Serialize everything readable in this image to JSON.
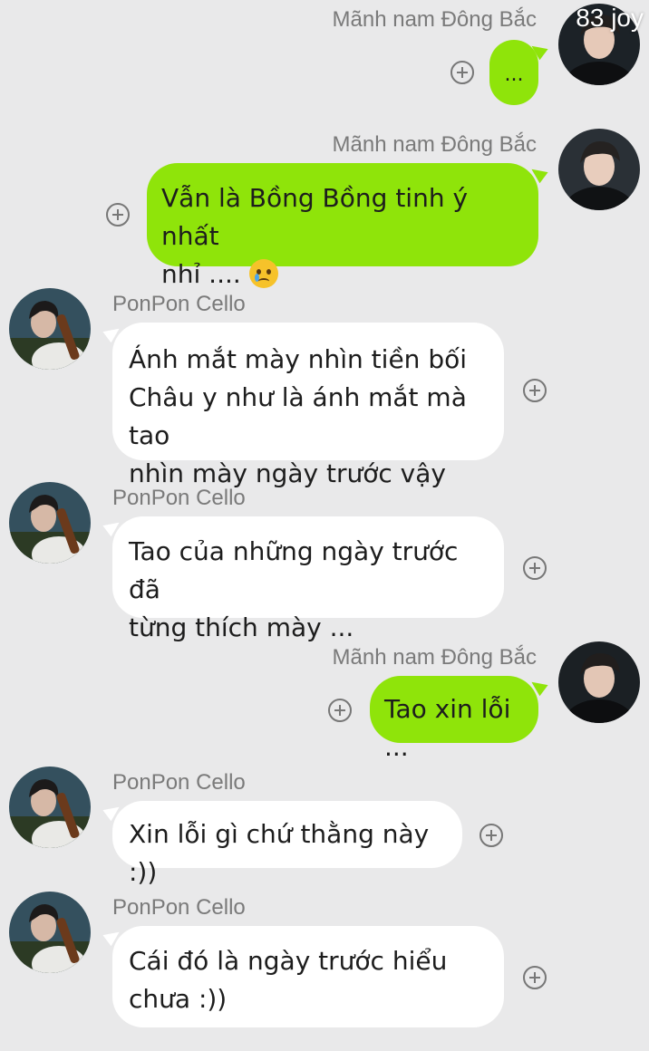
{
  "watermark": "83 joy",
  "messages": [
    {
      "sender": "Mãnh nam Đông Bắc",
      "text": "...",
      "side": "self"
    },
    {
      "sender": "Mãnh nam Đông Bắc",
      "text_lines": [
        "Vẫn là Bồng Bồng tinh ý nhất",
        "nhỉ .... "
      ],
      "emoji": "crying-face-emoji",
      "side": "self"
    },
    {
      "sender": "PonPon Cello",
      "text_lines": [
        "Ánh mắt mày nhìn tiền bối",
        "Châu y như là ánh mắt mà tao",
        "nhìn mày ngày trước vậy"
      ],
      "side": "other"
    },
    {
      "sender": "PonPon Cello",
      "text_lines": [
        "Tao của những ngày trước đã",
        "từng thích mày ..."
      ],
      "side": "other"
    },
    {
      "sender": "Mãnh nam Đông Bắc",
      "text": "Tao xin lỗi ...",
      "side": "self"
    },
    {
      "sender": "PonPon Cello",
      "text": "Xin lỗi gì chứ thằng này :))",
      "side": "other"
    },
    {
      "sender": "PonPon Cello",
      "text_lines": [
        "Cái đó là ngày trước hiểu",
        "chưa :))"
      ],
      "side": "other"
    }
  ],
  "colors": {
    "background": "#e9e9ea",
    "self_bubble": "#8fe40a",
    "other_bubble": "#ffffff",
    "sender_text": "#7a7a7a"
  },
  "icons": {
    "react": "add-reaction-icon"
  }
}
